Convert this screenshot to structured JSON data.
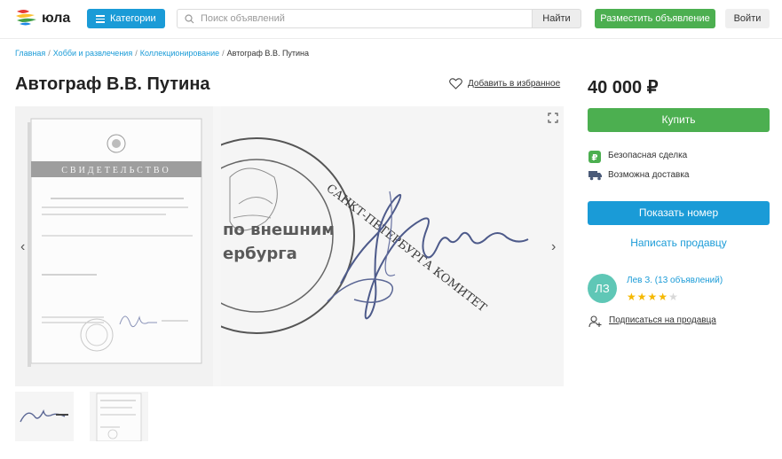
{
  "header": {
    "logo_text": "юла",
    "categories_label": "Категории",
    "search_placeholder": "Поиск объявлений",
    "find_label": "Найти",
    "post_ad_label": "Разместить объявление",
    "login_label": "Войти"
  },
  "breadcrumbs": [
    "Главная",
    "Хобби и развлечения",
    "Коллекционирование",
    "Автограф В.В. Путина"
  ],
  "listing": {
    "title": "Автограф В.В. Путина",
    "favorite_label": "Добавить в избранное",
    "price": "40 000 ₽",
    "buy_label": "Купить",
    "safe_deal": "Безопасная сделка",
    "delivery": "Возможна доставка",
    "show_phone_label": "Показать номер",
    "write_seller_label": "Написать продавцу"
  },
  "gallery": {
    "doc_heading": "СВИДЕТЕЛЬСТВО",
    "stamp_text_1": "по внешним",
    "stamp_text_2": "ербурга",
    "stamp_ring": "САНКТ-ПЕТЕРБУРГА КОМИТЕТ"
  },
  "seller": {
    "initials": "ЛЗ",
    "name": "Лев З. (13 объявлений)",
    "rating": 4,
    "rating_max": 5,
    "subscribe_label": "Подписаться на продавца"
  },
  "colors": {
    "accent_blue": "#1a9bd7",
    "accent_green": "#4caf50",
    "star": "#f5b800",
    "avatar": "#5fc7b6"
  }
}
